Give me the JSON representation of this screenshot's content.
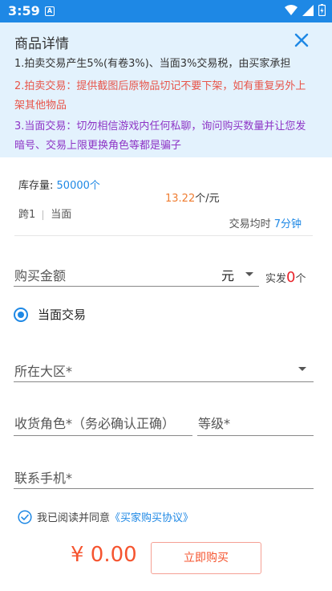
{
  "status_bar": {
    "time": "3:59",
    "notification_badge": "A"
  },
  "notice": {
    "title": "商品详情",
    "line1": "1.拍卖交易产生5%(有卷3%)、当面3%交易税，由买家承担",
    "line2": "2.拍卖交易：提供截图后原物品切记不要下架，如有重复另外上架其他物品",
    "line3": "3.当面交易：切勿相信游戏内任何私聊，询问购买数量并让您发暗号、交易上限更换角色等都是骗子"
  },
  "product": {
    "stock_label": "库存量:",
    "stock_value": "50000个",
    "server": "跨1",
    "trade_mode": "当面",
    "price_value": "13.22",
    "price_unit": "个/元",
    "avg_time_label": "交易均时",
    "avg_time_value": "7分钟"
  },
  "form": {
    "amount_placeholder": "购买金额",
    "amount_unit": "元",
    "actual_label": "实发",
    "actual_count": "0",
    "actual_unit": "个",
    "trade_option": "当面交易",
    "region_placeholder": "所在大区*",
    "role_placeholder": "收货角色*（务必确认正确）",
    "level_placeholder": "等级*",
    "phone_placeholder": "联系手机*"
  },
  "agreement": {
    "text": "我已阅读并同意",
    "link": "《买家购买协议》"
  },
  "footer": {
    "total": "¥ 0.00",
    "buy_label": "立即购买"
  },
  "colors": {
    "accent": "#1e88e5",
    "price": "#f07d32",
    "danger": "#f5542f",
    "notice_bg": "#e3f2fd"
  }
}
